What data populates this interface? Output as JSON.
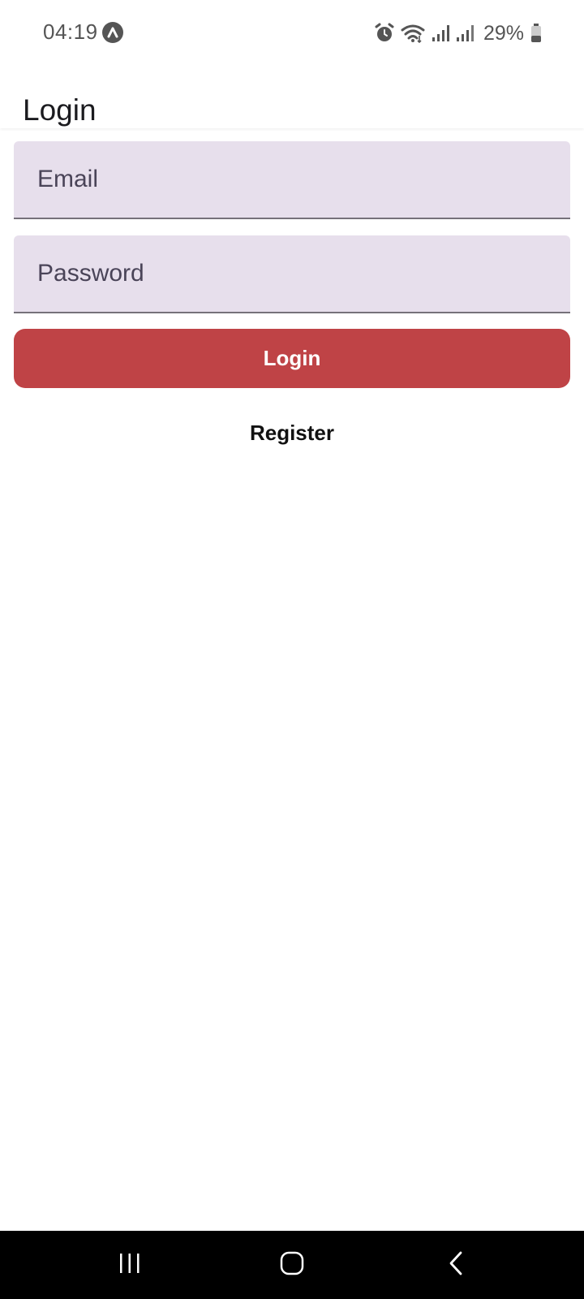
{
  "status_bar": {
    "time": "04:19",
    "battery": "29%",
    "icons": [
      "app-notification-icon",
      "alarm-icon",
      "wifi-icon",
      "signal-icon",
      "signal-icon",
      "battery-icon"
    ]
  },
  "app_bar": {
    "title": "Login"
  },
  "form": {
    "email": {
      "placeholder": "Email",
      "value": ""
    },
    "password": {
      "placeholder": "Password",
      "value": ""
    },
    "login_label": "Login",
    "register_label": "Register"
  },
  "colors": {
    "field_background": "#e7dfec",
    "login_button": "#bf4346",
    "nav_bar": "#000000"
  },
  "nav_bar": {
    "icons": [
      "recents-icon",
      "home-icon",
      "back-icon"
    ]
  }
}
